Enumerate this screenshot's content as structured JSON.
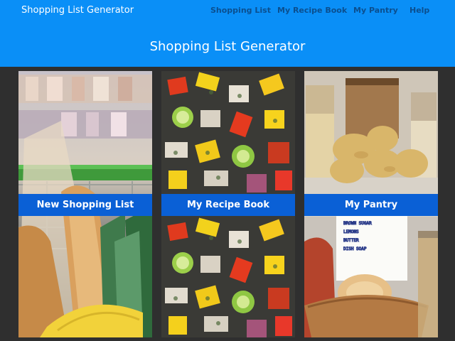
{
  "header": {
    "brand": "Shopping List Generator",
    "nav": [
      {
        "label": "Shopping List"
      },
      {
        "label": "My Recipe Book"
      },
      {
        "label": "My Pantry"
      },
      {
        "label": "Help"
      }
    ],
    "page_title": "Shopping List Generator"
  },
  "cards": [
    {
      "label": "New Shopping List",
      "image": "grocery-cart-photo"
    },
    {
      "label": "My Recipe Book",
      "image": "roasted-vegetables-photo"
    },
    {
      "label": "My Pantry",
      "image": "pantry-jars-photo"
    }
  ],
  "pantry_note": [
    "BROWN SUGAR",
    "LEMONS",
    "BUTTER",
    "DISH SOAP"
  ],
  "colors": {
    "header_bg": "#0a8ff7",
    "nav_text": "#0b4f8f",
    "banner_bg": "#0a60d6",
    "page_bg": "#2f2f2f"
  }
}
